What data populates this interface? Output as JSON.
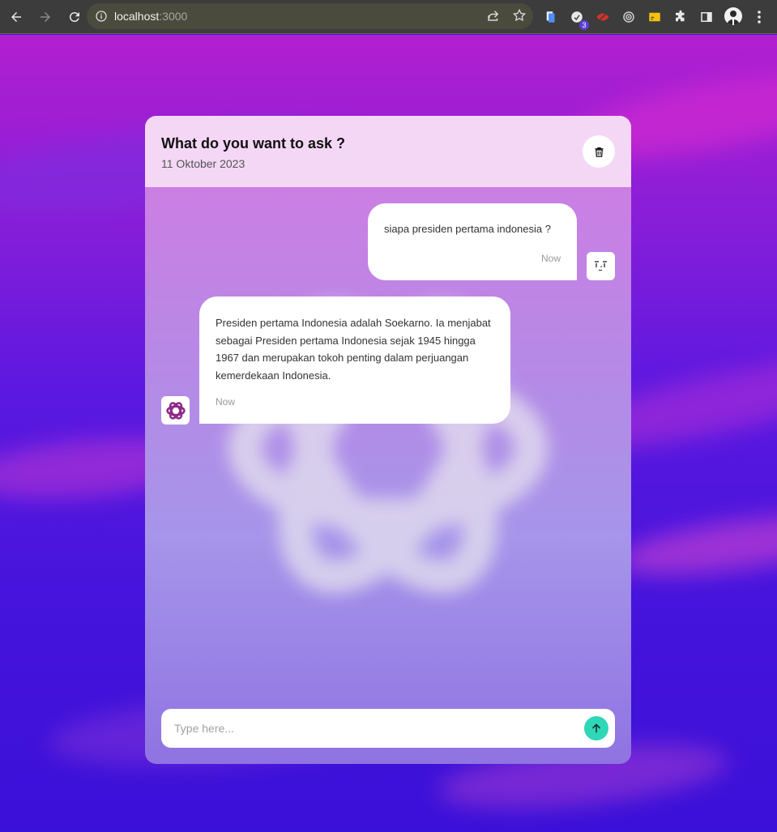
{
  "browser": {
    "url_host": "localhost",
    "url_port": ":3000",
    "extension_badge": "3"
  },
  "colors": {
    "accent_send": "#2fd6b8",
    "bot_logo": "#8e2a87",
    "background_top": "#b21fd0",
    "background_bottom": "#3b10d8"
  },
  "header": {
    "title": "What do you want to ask ?",
    "date": "11 Oktober 2023",
    "delete_icon": "trash-icon"
  },
  "messages": [
    {
      "role": "user",
      "text": "siapa presiden pertama indonesia ?",
      "time": "Now",
      "avatar_icon": "face-avatar-icon"
    },
    {
      "role": "assistant",
      "text": "Presiden pertama Indonesia adalah Soekarno. Ia menjabat sebagai Presiden pertama Indonesia sejak 1945 hingga 1967 dan merupakan tokoh penting dalam perjuangan kemerdekaan Indonesia.",
      "time": "Now",
      "avatar_icon": "openai-logo-icon"
    }
  ],
  "composer": {
    "placeholder": "Type here...",
    "value": "",
    "send_icon": "arrow-up-icon"
  }
}
